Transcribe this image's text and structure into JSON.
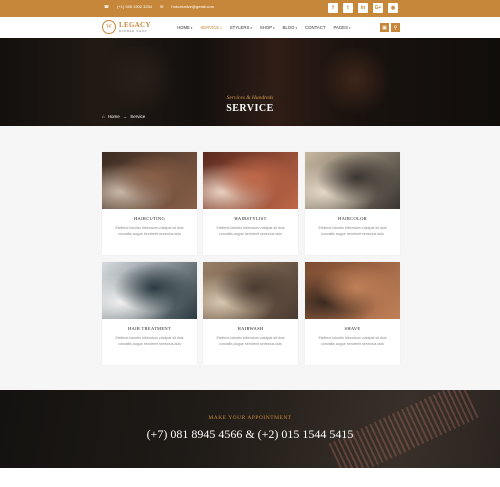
{
  "topbar": {
    "phone": "(+1) 945 1902 3234",
    "email": "hokcreative@gmail.com",
    "socials": [
      {
        "icon": "facebook-icon",
        "glyph": "f"
      },
      {
        "icon": "twitter-icon",
        "glyph": "t"
      },
      {
        "icon": "linkedin-icon",
        "glyph": "in"
      },
      {
        "icon": "google-plus-icon",
        "glyph": "G+"
      },
      {
        "icon": "rss-icon",
        "glyph": "◉"
      }
    ]
  },
  "logo": {
    "mark": "W",
    "name": "LEGACY",
    "tagline": "BARBER SHOP"
  },
  "nav": [
    {
      "label": "HOME",
      "dropdown": true,
      "active": false
    },
    {
      "label": "SERVICE",
      "dropdown": true,
      "active": true
    },
    {
      "label": "STYLERS",
      "dropdown": true,
      "active": false
    },
    {
      "label": "SHOP",
      "dropdown": true,
      "active": false
    },
    {
      "label": "BLOG",
      "dropdown": true,
      "active": false
    },
    {
      "label": "CONTACT",
      "dropdown": false,
      "active": false
    },
    {
      "label": "PAGES",
      "dropdown": true,
      "active": false
    }
  ],
  "header_buttons": [
    {
      "icon": "cart-icon",
      "glyph": "▣"
    },
    {
      "icon": "search-icon",
      "glyph": "⚲"
    }
  ],
  "hero": {
    "subtitle": "Services & Hundreds",
    "title": "SERVICE",
    "breadcrumb": {
      "home_icon": "home-icon",
      "home": "Home",
      "sep": "→",
      "current": "Service"
    }
  },
  "services": [
    {
      "title": "HAIRCUTING",
      "desc": "Eleifend lobortis bibendum volutpat sit duis convallis augue hendrerit senectus duis",
      "colors": [
        "#3a2a20",
        "#8a6048",
        "#c9b8a8"
      ]
    },
    {
      "title": "HAIRSTYLIST",
      "desc": "Eleifend lobortis bibendum volutpat sit duis convallis augue hendrerit senectus duis",
      "colors": [
        "#5a2a20",
        "#c06848",
        "#e8d0c0"
      ]
    },
    {
      "title": "HAIRCOLOR",
      "desc": "Eleifend lobortis bibendum volutpat sit duis convallis augue hendrerit senectus duis",
      "colors": [
        "#c8b8a0",
        "#3a3530",
        "#e4d8c8"
      ]
    },
    {
      "title": "HAIR TREATMENT",
      "desc": "Eleifend lobortis bibendum volutpat sit duis convallis augue hendrerit senectus duis",
      "colors": [
        "#d8dce0",
        "#2a3a40",
        "#f0f0f0"
      ]
    },
    {
      "title": "HAIRWASH",
      "desc": "Eleifend lobortis bibendum volutpat sit duis convallis augue hendrerit senectus duis",
      "colors": [
        "#9a8068",
        "#4a3a30",
        "#d8c8b0"
      ]
    },
    {
      "title": "SHAVE",
      "desc": "Eleifend lobortis bibendum volutpat sit duis convallis augue hendrerit senectus duis",
      "colors": [
        "#7a4a30",
        "#c08058",
        "#3a2a20"
      ]
    }
  ],
  "appointment": {
    "label": "MAKE YOUR APPOINTMENT",
    "phone": "(+7) 081 8945 4566 & (+2) 015 1544 5415"
  },
  "colors": {
    "accent": "#c7873a"
  }
}
